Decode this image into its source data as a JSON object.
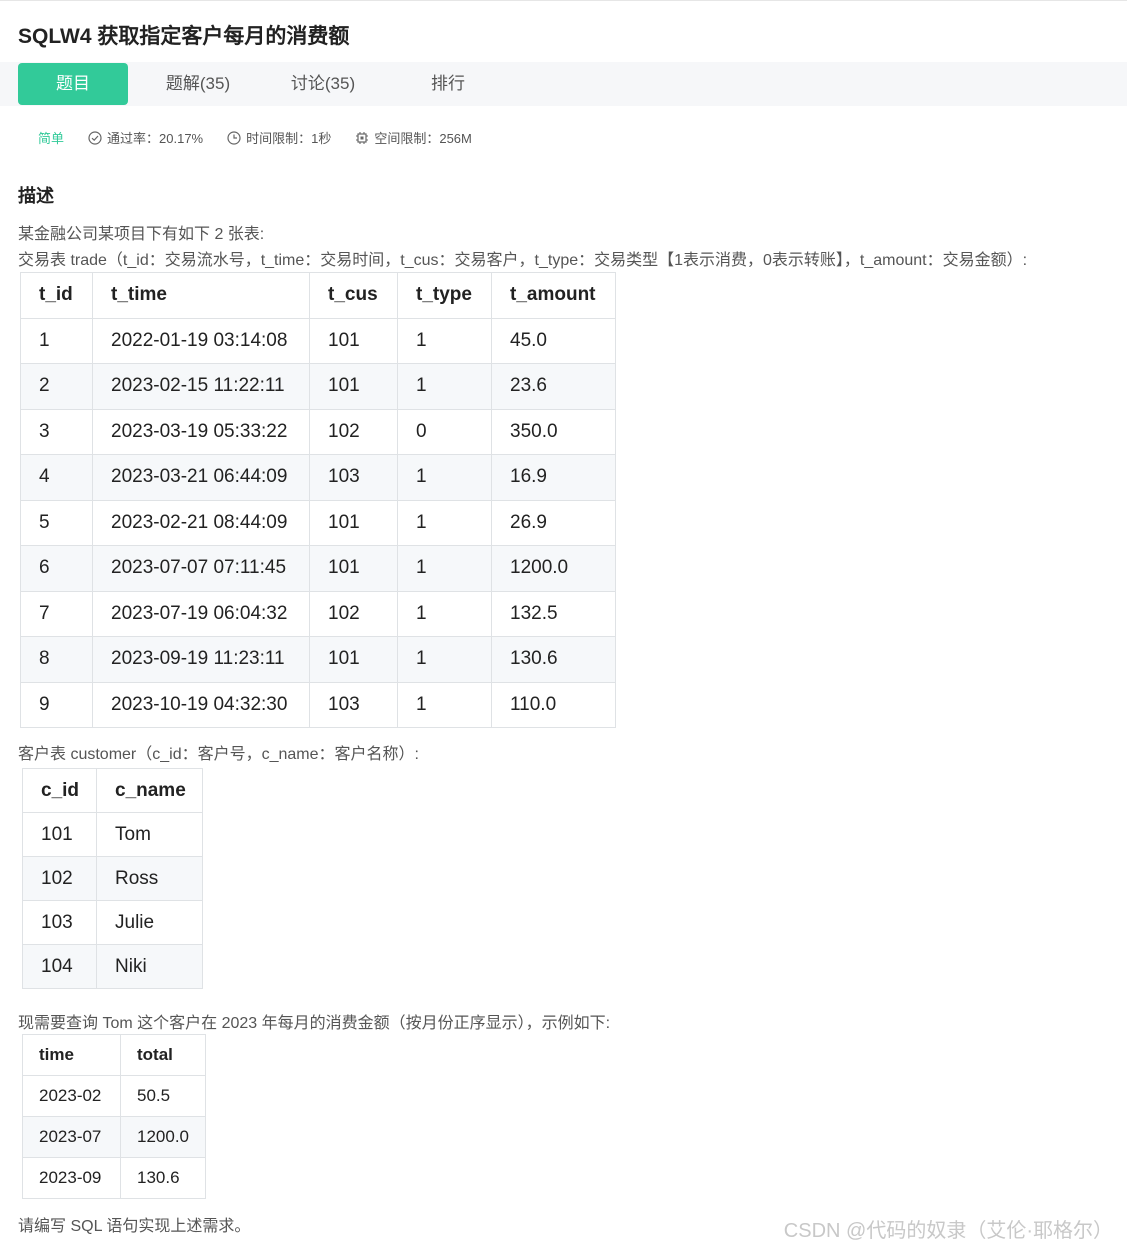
{
  "title": "SQLW4  获取指定客户每月的消费额",
  "tabs": [
    {
      "label": "题目",
      "active": true
    },
    {
      "label": "题解(35)"
    },
    {
      "label": "讨论(35)"
    },
    {
      "label": "排行"
    }
  ],
  "meta": {
    "difficulty": "简单",
    "pass_rate": "通过率：20.17%",
    "time_limit": "时间限制：1秒",
    "memory_limit": "空间限制：256M"
  },
  "description": {
    "heading": "描述",
    "intro": "某金融公司某项目下有如下 2 张表:",
    "trade_desc": "交易表 trade（t_id：交易流水号，t_time：交易时间，t_cus：交易客户，t_type：交易类型【1表示消费，0表示转账】，t_amount：交易金额）:",
    "customer_desc": "客户表 customer（c_id：客户号，c_name：客户名称）:",
    "query_desc": "现需要查询 Tom 这个客户在 2023 年每月的消费金额（按月份正序显示），示例如下:",
    "ending": "请编写 SQL 语句实现上述需求。"
  },
  "trade_table": {
    "headers": [
      "t_id",
      "t_time",
      "t_cus",
      "t_type",
      "t_amount"
    ],
    "rows": [
      [
        "1",
        "2022-01-19 03:14:08",
        "101",
        "1",
        "45.0"
      ],
      [
        "2",
        "2023-02-15 11:22:11",
        "101",
        "1",
        "23.6"
      ],
      [
        "3",
        "2023-03-19 05:33:22",
        "102",
        "0",
        "350.0"
      ],
      [
        "4",
        "2023-03-21 06:44:09",
        "103",
        "1",
        "16.9"
      ],
      [
        "5",
        "2023-02-21 08:44:09",
        "101",
        "1",
        "26.9"
      ],
      [
        "6",
        "2023-07-07 07:11:45",
        "101",
        "1",
        "1200.0"
      ],
      [
        "7",
        "2023-07-19 06:04:32",
        "102",
        "1",
        "132.5"
      ],
      [
        "8",
        "2023-09-19 11:23:11",
        "101",
        "1",
        "130.6"
      ],
      [
        "9",
        "2023-10-19 04:32:30",
        "103",
        "1",
        "110.0"
      ]
    ]
  },
  "customer_table": {
    "headers": [
      "c_id",
      "c_name"
    ],
    "rows": [
      [
        "101",
        "Tom"
      ],
      [
        "102",
        "Ross"
      ],
      [
        "103",
        "Julie"
      ],
      [
        "104",
        "Niki"
      ]
    ]
  },
  "result_table": {
    "headers": [
      "time",
      "total"
    ],
    "rows": [
      [
        "2023-02",
        "50.5"
      ],
      [
        "2023-07",
        "1200.0"
      ],
      [
        "2023-09",
        "130.6"
      ]
    ]
  },
  "watermark": "CSDN @代码的奴隶（艾伦·耶格尔）",
  "colors": {
    "accent": "#32ca99",
    "tabbar_bg": "#f6f7f9",
    "stripe": "#f6f8fa"
  }
}
